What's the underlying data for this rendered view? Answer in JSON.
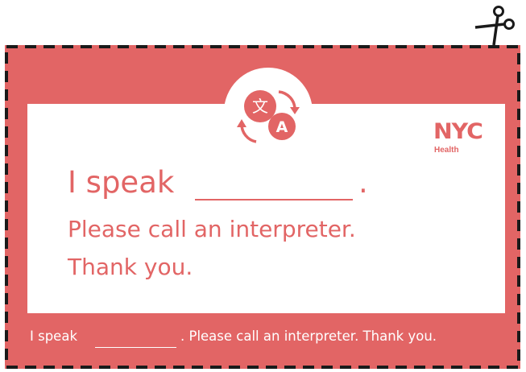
{
  "card": {
    "line1_prefix": "I speak",
    "line1_suffix": ".",
    "line2": "Please call an interpreter.",
    "line3": "Thank you.",
    "footer_prefix": "I speak",
    "footer_rest": ". Please call an interpreter. Thank you."
  },
  "logo": {
    "brand": "NYC",
    "sub": "Health"
  },
  "icons": {
    "badge": "translate-icon",
    "scissors": "scissors-icon",
    "badge_glyph_1": "文",
    "badge_glyph_2": "A"
  },
  "colors": {
    "accent": "#e26565",
    "background": "#ffffff"
  }
}
